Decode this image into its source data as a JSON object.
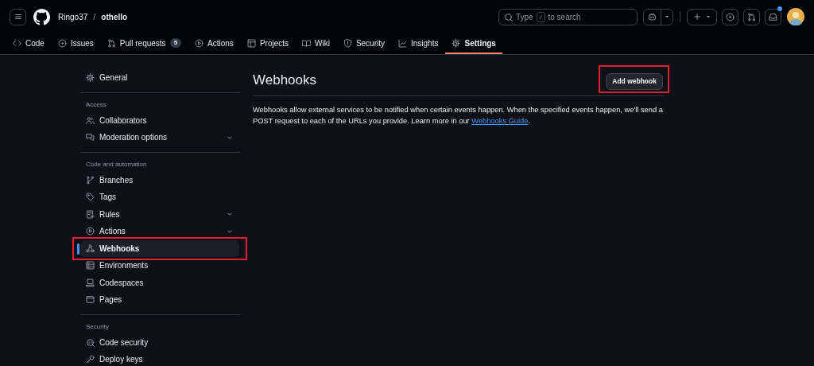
{
  "header": {
    "owner": "Ringo37",
    "separator": "/",
    "repo": "othello",
    "search": {
      "placeholder_before": "Type",
      "key": "/",
      "placeholder_after": "to search"
    },
    "notifications_unread": true
  },
  "tabs": [
    {
      "label": "Code",
      "selected": false
    },
    {
      "label": "Issues",
      "selected": false
    },
    {
      "label": "Pull requests",
      "count": "5",
      "selected": false
    },
    {
      "label": "Actions",
      "selected": false
    },
    {
      "label": "Projects",
      "selected": false
    },
    {
      "label": "Wiki",
      "selected": false
    },
    {
      "label": "Security",
      "selected": false
    },
    {
      "label": "Insights",
      "selected": false
    },
    {
      "label": "Settings",
      "selected": true
    }
  ],
  "sidebar": {
    "sections": [
      {
        "items": [
          {
            "label": "General",
            "selected": false,
            "expandable": false,
            "highlighted": false
          }
        ]
      },
      {
        "heading": "Access",
        "items": [
          {
            "label": "Collaborators",
            "selected": false,
            "expandable": false,
            "highlighted": false
          },
          {
            "label": "Moderation options",
            "selected": false,
            "expandable": true,
            "highlighted": false
          }
        ]
      },
      {
        "heading": "Code and automation",
        "items": [
          {
            "label": "Branches",
            "selected": false,
            "expandable": false,
            "highlighted": false
          },
          {
            "label": "Tags",
            "selected": false,
            "expandable": false,
            "highlighted": false
          },
          {
            "label": "Rules",
            "selected": false,
            "expandable": true,
            "highlighted": false
          },
          {
            "label": "Actions",
            "selected": false,
            "expandable": true,
            "highlighted": false
          },
          {
            "label": "Webhooks",
            "selected": true,
            "expandable": false,
            "highlighted": true
          },
          {
            "label": "Environments",
            "selected": false,
            "expandable": false,
            "highlighted": false
          },
          {
            "label": "Codespaces",
            "selected": false,
            "expandable": false,
            "highlighted": false
          },
          {
            "label": "Pages",
            "selected": false,
            "expandable": false,
            "highlighted": false
          }
        ]
      },
      {
        "heading": "Security",
        "items": [
          {
            "label": "Code security",
            "selected": false,
            "expandable": false,
            "highlighted": false
          },
          {
            "label": "Deploy keys",
            "selected": false,
            "expandable": false,
            "highlighted": false
          }
        ]
      }
    ]
  },
  "main": {
    "title": "Webhooks",
    "add_button": {
      "label": "Add webhook",
      "highlighted": true
    },
    "description": "Webhooks allow external services to be notified when certain events happen. When the specified events happen, we'll send a POST request to each of the URLs you provide. Learn more in our ",
    "link": "Webhooks Guide",
    "description_end": "."
  }
}
